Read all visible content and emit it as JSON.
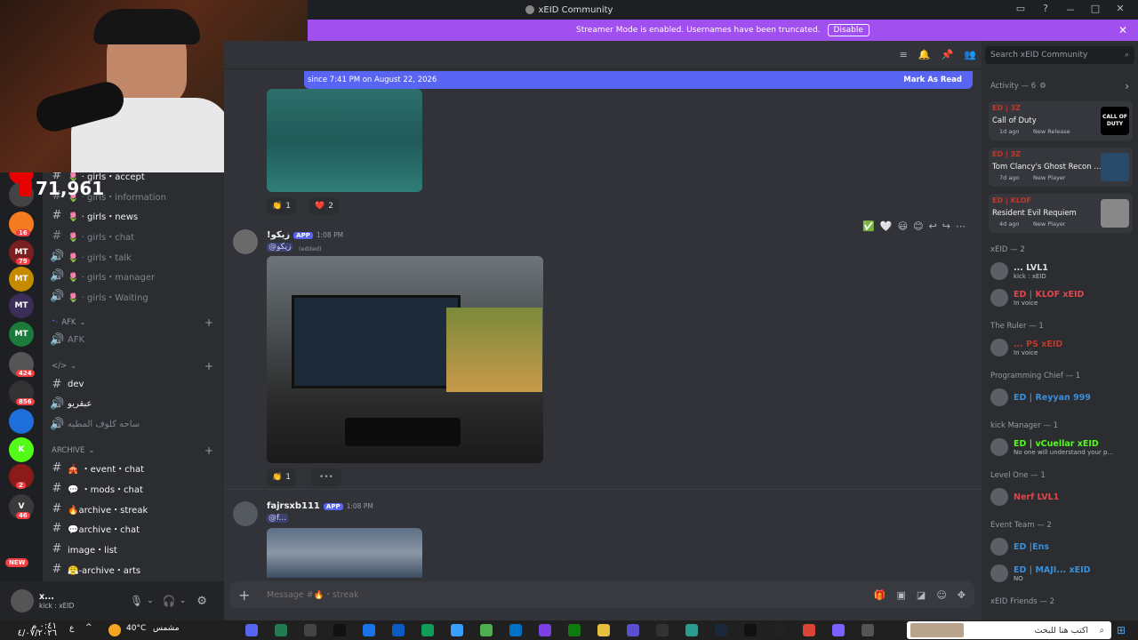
{
  "window": {
    "title": "xEID Community",
    "controls": [
      "▭",
      "?",
      "－",
      "□",
      "✕"
    ]
  },
  "banner": {
    "text": "Streamer Mode is enabled. Usernames have been truncated.",
    "button": "Disable"
  },
  "viewer": {
    "count": "71,961"
  },
  "servers": [
    {
      "label": "",
      "color": "#e60000",
      "badge": ""
    },
    {
      "label": "",
      "color": "#444",
      "badge": ""
    },
    {
      "label": "",
      "color": "#f47b20",
      "badge": "16"
    },
    {
      "label": "MT",
      "color": "#7a1f1f",
      "badge": "79"
    },
    {
      "label": "MT",
      "color": "#c58a00",
      "badge": ""
    },
    {
      "label": "MT",
      "color": "#3b2f5a",
      "badge": ""
    },
    {
      "label": "MT",
      "color": "#1c7a3a",
      "badge": ""
    },
    {
      "label": "",
      "color": "#555",
      "badge": "424"
    },
    {
      "label": "",
      "color": "#333",
      "badge": "856"
    },
    {
      "label": "",
      "color": "#1e6fd9",
      "badge": ""
    },
    {
      "label": "K",
      "color": "#53fc18",
      "badge": ""
    },
    {
      "label": "",
      "color": "#8b1a1a",
      "badge": "2"
    },
    {
      "label": "V",
      "color": "#3a3a3a",
      "badge": "46"
    }
  ],
  "channels": [
    {
      "icon": "#",
      "label": "🌷 · girls・accept",
      "bright": true
    },
    {
      "icon": "#",
      "label": "🌷 · girls・information",
      "bright": false
    },
    {
      "icon": "#",
      "label": "🌷 · girls・news",
      "bright": true
    },
    {
      "icon": "#",
      "label": "🌷 · girls・chat",
      "bright": false
    },
    {
      "icon": "🔊",
      "label": "🌷 · girls・talk",
      "bright": false
    },
    {
      "icon": "🔊",
      "label": "🌷 · girls・manager",
      "bright": false
    },
    {
      "icon": "🔊",
      "label": "🌷 · girls・Waiting",
      "bright": false
    }
  ],
  "cat_afk": "AFK",
  "ch_afk": "AFK",
  "cat_dev": "</>",
  "dev_channels": [
    {
      "icon": "#",
      "label": "dev",
      "bright": true
    },
    {
      "icon": "🔊",
      "label": "عبقريو",
      "bright": true
    },
    {
      "icon": "🔊",
      "label": "ساحه كلوف المطيه",
      "bright": false
    }
  ],
  "cat_archive": "ARCHIVE",
  "archive_channels": [
    {
      "icon": "#",
      "label": "🎪 ・event・chat",
      "bright": true
    },
    {
      "icon": "#",
      "label": "💬 ・mods・chat",
      "bright": true
    },
    {
      "icon": "#",
      "label": "🔥archive・streak",
      "bright": true
    },
    {
      "icon": "#",
      "label": "💬archive・chat",
      "bright": true
    },
    {
      "icon": "#",
      "label": "image・list",
      "bright": true
    },
    {
      "icon": "#",
      "label": "😤-archive・arts",
      "bright": true
    }
  ],
  "user": {
    "name": "x...",
    "status": "kick : xEID"
  },
  "newbar": {
    "text": "since 7:41 PM on August 22, 2026",
    "action": "Mark As Read"
  },
  "messages": [
    {
      "reactions": [
        {
          "emoji": "👏",
          "count": "1"
        },
        {
          "emoji": "❤️",
          "count": "2"
        }
      ]
    },
    {
      "author": "!زيكو",
      "tag": "APP",
      "time": "1:08 PM",
      "mention": "@زيكو",
      "edited": "(edited)",
      "reactions": [
        {
          "emoji": "👏",
          "count": "1"
        }
      ]
    },
    {
      "author": "fajrsxb111",
      "tag": "APP",
      "time": "1:08 PM",
      "mention": "@f..."
    }
  ],
  "hover_actions": [
    "✅",
    "🤍",
    "😃",
    "😊",
    "↩",
    "↪",
    "⋯"
  ],
  "composer": {
    "placeholder": "Message #🔥・streak"
  },
  "search": {
    "placeholder": "Search xEID Community"
  },
  "activity": {
    "header": "Activity — 6",
    "cards": [
      {
        "user": "ED | 3Z",
        "game": "Call of Duty",
        "meta": "1d ago",
        "tag": "New Release",
        "logo": "CALL OF DUTY"
      },
      {
        "user": "ED | 3Z",
        "game": "Tom Clancy's Ghost Recon ...",
        "meta": "7d ago",
        "tag": "New Player",
        "logo": ""
      },
      {
        "user": "ED | KLOF",
        "game": "Resident Evil Requiem",
        "meta": "4d ago",
        "tag": "New Player",
        "logo": ""
      }
    ]
  },
  "member_groups": [
    {
      "title": "xEID — 2",
      "members": [
        {
          "name": "... LVL1",
          "sub": "kick : xEID",
          "color": "#dbdee1"
        },
        {
          "name": "ED | KLOF xEID",
          "sub": "In voice",
          "color": "#e0464b"
        }
      ]
    },
    {
      "title": "The Ruler — 1",
      "members": [
        {
          "name": "... PS xEID",
          "sub": "In voice",
          "color": "#c0392b"
        }
      ]
    },
    {
      "title": "Programming Chief — 1",
      "members": [
        {
          "name": "ED | Reyyan 999",
          "sub": "",
          "color": "#3b8fd9"
        }
      ]
    },
    {
      "title": "kick Manager — 1",
      "members": [
        {
          "name": "ED | vCuellar xEID",
          "sub": "No one will understand your p...",
          "color": "#53fc18"
        }
      ]
    },
    {
      "title": "Level One — 1",
      "members": [
        {
          "name": "Nerf LVL1",
          "sub": "",
          "color": "#e0464b"
        }
      ]
    },
    {
      "title": "Event Team — 2",
      "members": [
        {
          "name": "ED |Ens",
          "sub": "",
          "color": "#3b8fd9"
        },
        {
          "name": "ED | MAJI... xEID",
          "sub": "NO",
          "color": "#3b8fd9"
        }
      ]
    },
    {
      "title": "xEID Friends — 2",
      "members": []
    }
  ],
  "taskbar": {
    "weather": "40°C",
    "weather_text": "مشمس",
    "search": "اكتب هنا للبحث",
    "time": "٠:٤١ م",
    "date": "٤/٠٧/٢٠٢٦",
    "lang": "ع"
  }
}
